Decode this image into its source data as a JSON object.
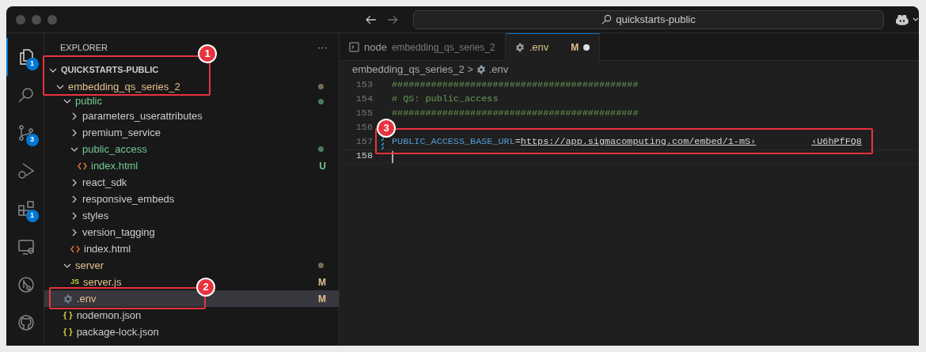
{
  "title_bar": {
    "search": "quickstarts-public"
  },
  "activity_bar": [
    {
      "selected": true,
      "badge": "1"
    },
    {
      "selected": false
    },
    {
      "selected": false,
      "badge": "3"
    },
    {
      "selected": false
    },
    {
      "selected": false,
      "badge": "1"
    },
    {
      "selected": false
    },
    {
      "selected": false
    },
    {
      "selected": false
    }
  ],
  "sidebar": {
    "title": "EXPLORER",
    "more": "···",
    "tree": [
      {
        "name": "QUICKSTARTS-PUBLIC",
        "kind": "root",
        "expanded": true,
        "children": [
          {
            "name": "embedding_qs_series_2",
            "kind": "folder",
            "expanded": true,
            "modified": true,
            "untracked": false,
            "changes_dot": true,
            "children": [
              {
                "name": "public",
                "kind": "folder",
                "expanded": true,
                "modified": false,
                "untracked": true,
                "changes_dot": true,
                "children": [
                  {
                    "name": "parameters_userattributes",
                    "kind": "folder",
                    "expanded": false,
                    "modified": false,
                    "untracked": false,
                    "changes_dot": false
                  },
                  {
                    "name": "premium_service",
                    "kind": "folder",
                    "expanded": false,
                    "modified": false,
                    "untracked": false,
                    "changes_dot": false
                  },
                  {
                    "name": "public_access",
                    "kind": "folder",
                    "expanded": true,
                    "modified": false,
                    "untracked": true,
                    "changes_dot": true,
                    "children": [
                      {
                        "name": "index.html",
                        "kind": "html",
                        "modified": false,
                        "untracked": true,
                        "badge": "U"
                      }
                    ]
                  },
                  {
                    "name": "react_sdk",
                    "kind": "folder",
                    "expanded": false,
                    "modified": false,
                    "untracked": false,
                    "changes_dot": false
                  },
                  {
                    "name": "responsive_embeds",
                    "kind": "folder",
                    "expanded": false,
                    "modified": false,
                    "untracked": false,
                    "changes_dot": false
                  },
                  {
                    "name": "styles",
                    "kind": "folder",
                    "expanded": false,
                    "modified": false,
                    "untracked": false,
                    "changes_dot": false
                  },
                  {
                    "name": "version_tagging",
                    "kind": "folder",
                    "expanded": false,
                    "modified": false,
                    "untracked": false,
                    "changes_dot": false
                  },
                  {
                    "name": "index.html",
                    "kind": "html",
                    "modified": false,
                    "untracked": false
                  }
                ]
              },
              {
                "name": "server",
                "kind": "folder",
                "expanded": true,
                "modified": true,
                "untracked": false,
                "changes_dot": true,
                "children": [
                  {
                    "name": "server.js",
                    "kind": "js",
                    "icon_text": "JS",
                    "modified": true,
                    "untracked": false,
                    "badge": "M"
                  }
                ]
              },
              {
                "name": ".env",
                "kind": "env",
                "modified": true,
                "untracked": false,
                "badge": "M",
                "selected": true
              },
              {
                "name": "nodemon.json",
                "kind": "json",
                "icon_text": "{ }",
                "modified": false,
                "untracked": false,
                "selected": false
              },
              {
                "name": "package-lock.json",
                "kind": "json",
                "icon_text": "{ }",
                "modified": false,
                "untracked": false,
                "selected": false
              }
            ]
          }
        ]
      }
    ]
  },
  "tabs": [
    {
      "kind": "terminal",
      "label": "node",
      "description": "embedding_qs_series_2",
      "selected": false
    },
    {
      "kind": "file",
      "label": ".env",
      "status": "M",
      "dirty": true,
      "selected": true
    }
  ],
  "breadcrumb": {
    "folder": "embedding_qs_series_2",
    "separator": ">",
    "file": ".env"
  },
  "editor": {
    "lines": [
      {
        "number": "153",
        "kind": "comment",
        "text": "############################################"
      },
      {
        "number": "154",
        "kind": "comment",
        "text": "# QS: public_access"
      },
      {
        "number": "155",
        "kind": "comment",
        "text": "############################################"
      },
      {
        "number": "156",
        "kind": "blank"
      },
      {
        "number": "157",
        "kind": "assignment",
        "modified": true,
        "key": "PUBLIC_ACCESS_BASE_URL",
        "equals": "=",
        "value": "https://app.sigmacomputing.com/embed/1-mS›",
        "value_end": "‹U6hPfFQ8"
      },
      {
        "number": "158",
        "kind": "blank",
        "current": true
      }
    ]
  },
  "annotations": [
    {
      "number": "1"
    },
    {
      "number": "2"
    },
    {
      "number": "3"
    }
  ]
}
